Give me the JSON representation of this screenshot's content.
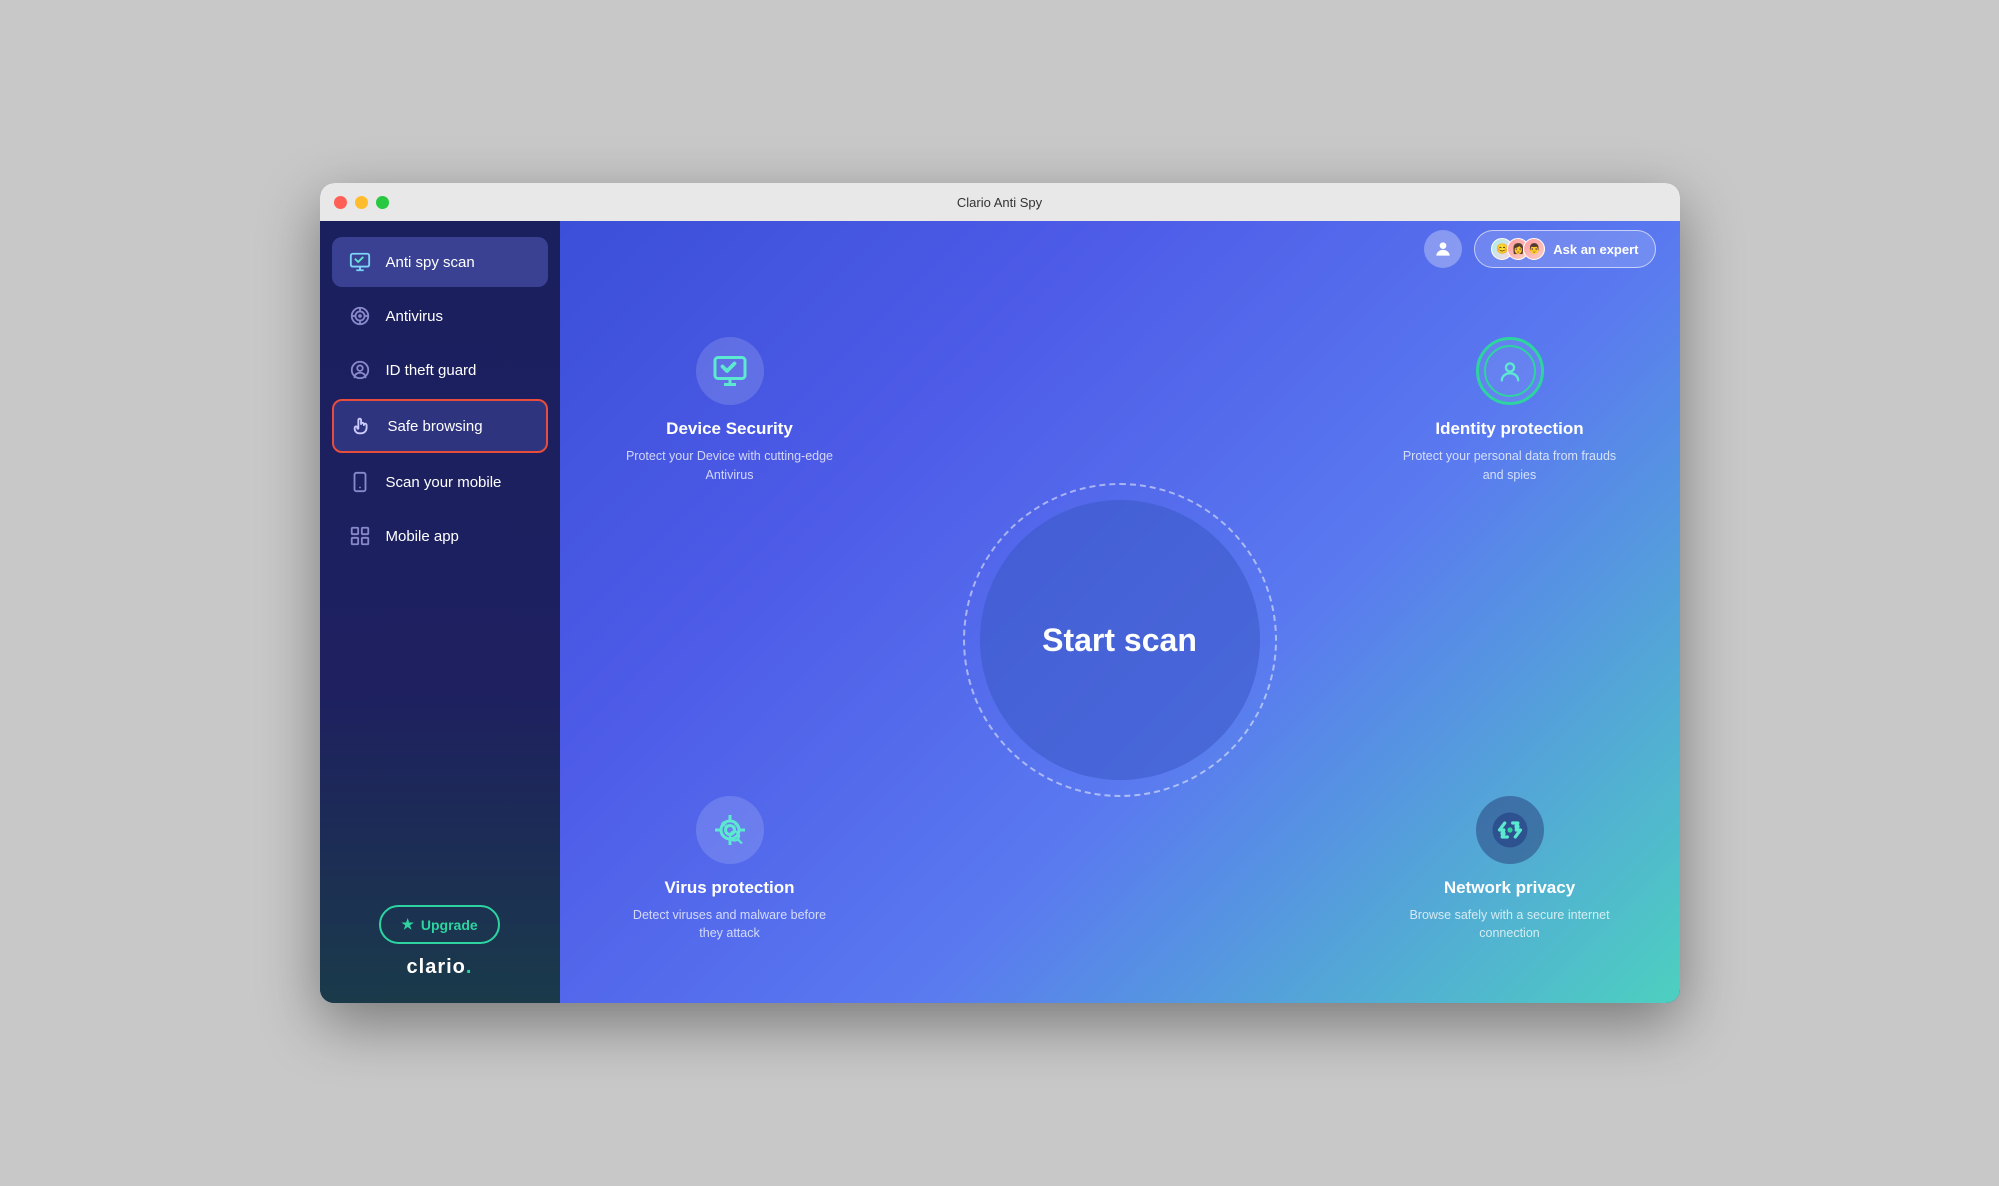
{
  "window": {
    "title": "Clario Anti Spy"
  },
  "titlebar": {
    "title": "Clario Anti Spy"
  },
  "sidebar": {
    "nav_items": [
      {
        "id": "anti-spy-scan",
        "label": "Anti spy scan",
        "icon": "monitor-icon",
        "active": true
      },
      {
        "id": "antivirus",
        "label": "Antivirus",
        "icon": "antivirus-icon",
        "active": false
      },
      {
        "id": "id-theft-guard",
        "label": "ID theft guard",
        "icon": "id-theft-icon",
        "active": false
      },
      {
        "id": "safe-browsing",
        "label": "Safe browsing",
        "icon": "hand-icon",
        "active": false,
        "selected": true
      },
      {
        "id": "scan-mobile",
        "label": "Scan your mobile",
        "icon": "mobile-icon",
        "active": false
      },
      {
        "id": "mobile-app",
        "label": "Mobile app",
        "icon": "grid-icon",
        "active": false
      }
    ],
    "upgrade_button": "Upgrade",
    "logo": "clario"
  },
  "topbar": {
    "ask_expert_label": "Ask an expert"
  },
  "main": {
    "scan_button": "Start scan",
    "features": [
      {
        "id": "device-security",
        "title": "Device Security",
        "description": "Protect your Device with cutting-edge Antivirus",
        "position": "top-left"
      },
      {
        "id": "identity-protection",
        "title": "Identity protection",
        "description": "Protect your personal data from frauds and spies",
        "position": "top-right"
      },
      {
        "id": "virus-protection",
        "title": "Virus protection",
        "description": "Detect viruses and malware before they attack",
        "position": "bottom-left"
      },
      {
        "id": "network-privacy",
        "title": "Network privacy",
        "description": "Browse safely with a secure internet connection",
        "position": "bottom-right"
      }
    ]
  }
}
